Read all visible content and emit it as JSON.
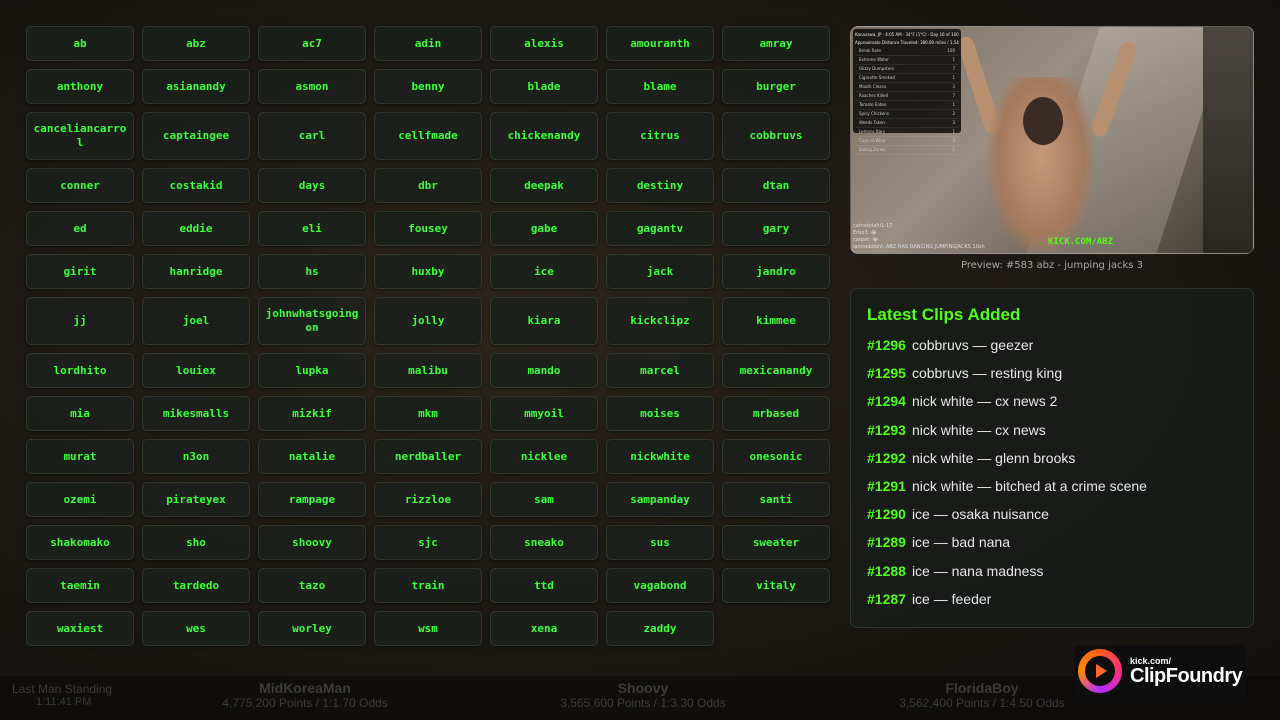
{
  "buttons": [
    "ab",
    "abz",
    "ac7",
    "adin",
    "alexis",
    "amouranth",
    "amray",
    "anthony",
    "asianandy",
    "asmon",
    "benny",
    "blade",
    "blame",
    "burger",
    "canceliancarrol",
    "captaingee",
    "carl",
    "cellfmade",
    "chickenandy",
    "citrus",
    "cobbruvs",
    "conner",
    "costakid",
    "days",
    "dbr",
    "deepak",
    "destiny",
    "dtan",
    "ed",
    "eddie",
    "eli",
    "fousey",
    "gabe",
    "gagantv",
    "gary",
    "girit",
    "hanridge",
    "hs",
    "huxby",
    "ice",
    "jack",
    "jandro",
    "jj",
    "joel",
    "johnwhatsgoingon",
    "jolly",
    "kiara",
    "kickclipz",
    "kimmee",
    "lordhito",
    "louiex",
    "lupka",
    "malibu",
    "mando",
    "marcel",
    "mexicanandy",
    "mia",
    "mikesmalls",
    "mizkif",
    "mkm",
    "mmyoil",
    "moises",
    "mrbased",
    "murat",
    "n3on",
    "natalie",
    "nerdballer",
    "nicklee",
    "nickwhite",
    "onesonic",
    "ozemi",
    "pirateyex",
    "rampage",
    "rizzloe",
    "sam",
    "sampanday",
    "santi",
    "shakomako",
    "sho",
    "shoovy",
    "sjc",
    "sneako",
    "sus",
    "sweater",
    "taemin",
    "tardedo",
    "tazo",
    "train",
    "ttd",
    "vagabond",
    "vitaly",
    "waxiest",
    "wes",
    "worley",
    "wsm",
    "xena",
    "zaddy"
  ],
  "preview": {
    "caption": "Preview: #583 abz - jumping jacks 3",
    "overlay_header": "Kanazawa, JP · 4:05 AM · 34°F (1°C) · Day 16 of 100",
    "overlay_sub": "Approximate Distance Traveled: 380.00 miles / 1,543.12 km",
    "overlay_rows": [
      {
        "name": "Break Rate",
        "val": "100"
      },
      {
        "name": "Extreme Water",
        "val": "1"
      },
      {
        "name": "Glizzy Dumpsters",
        "val": "7"
      },
      {
        "name": "Cigarette Smoked",
        "val": "1"
      },
      {
        "name": "Mouth Cleans",
        "val": "3"
      },
      {
        "name": "Roaches Killed",
        "val": "7"
      },
      {
        "name": "Tomato Eaten",
        "val": "1"
      },
      {
        "name": "Spicy Chickens",
        "val": "2"
      },
      {
        "name": "Weeds Taken",
        "val": "3"
      },
      {
        "name": "Lemons Bars",
        "val": "1"
      },
      {
        "name": "Cups of Wine",
        "val": "2"
      },
      {
        "name": "Eating Zones",
        "val": "1"
      }
    ],
    "chat": [
      "catnebdahl1:17",
      "Erbo3: 😂",
      "carpet: 😂",
      "iamnebdahl: ABZ HAS DANCING JUMPINGJACKS 10sh"
    ],
    "watermark": "KICK.COM/ABZ"
  },
  "clips": {
    "title": "Latest Clips Added",
    "items": [
      {
        "num": "#1296",
        "text": "cobbruvs — geezer"
      },
      {
        "num": "#1295",
        "text": "cobbruvs — resting king"
      },
      {
        "num": "#1294",
        "text": "nick white — cx news 2"
      },
      {
        "num": "#1293",
        "text": "nick white — cx news"
      },
      {
        "num": "#1292",
        "text": "nick white — glenn brooks"
      },
      {
        "num": "#1291",
        "text": "nick white — bitched at a crime scene"
      },
      {
        "num": "#1290",
        "text": "ice — osaka nuisance"
      },
      {
        "num": "#1289",
        "text": "ice — bad nana"
      },
      {
        "num": "#1288",
        "text": "ice — nana madness"
      },
      {
        "num": "#1287",
        "text": "ice — feeder"
      }
    ]
  },
  "ticker": {
    "left_title": "Last Man Standing",
    "left_time": "1:11:41 PM",
    "items": [
      {
        "name": "MidKoreaMan",
        "stats": "4,775,200 Points / 1:1.70 Odds"
      },
      {
        "name": "Shoovy",
        "stats": "3,565,600 Points / 1:3.30 Odds"
      },
      {
        "name": "FloridaBoy",
        "stats": "3,562,400 Points / 1:4.50 Odds"
      }
    ]
  },
  "logo": {
    "line1": "kick.com/",
    "line2": "ClipFoundry"
  },
  "colors": {
    "accent": "#53fc18",
    "button_text": "#3cff3c"
  }
}
